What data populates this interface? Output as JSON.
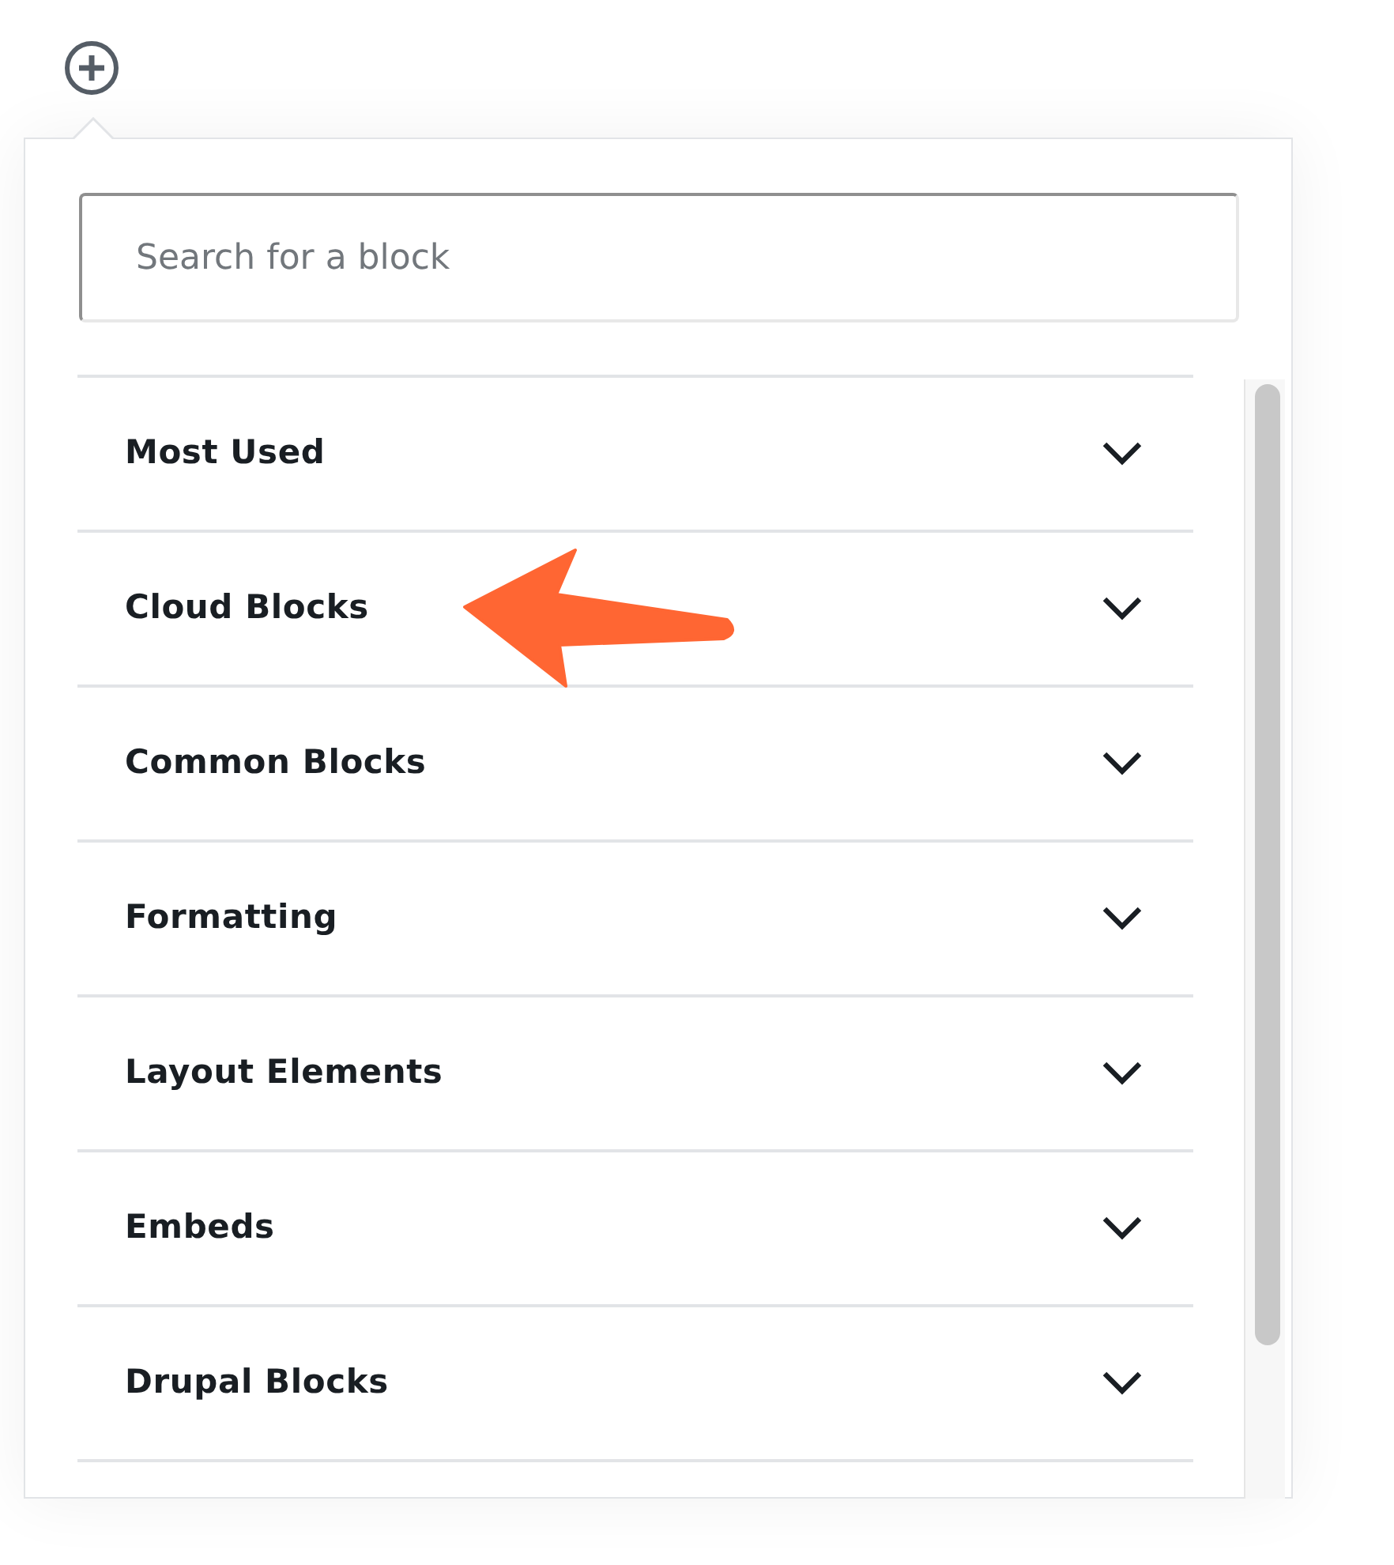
{
  "search": {
    "placeholder": "Search for a block"
  },
  "categories": [
    {
      "label": "Most Used",
      "expanded": false
    },
    {
      "label": "Cloud Blocks",
      "expanded": false
    },
    {
      "label": "Common Blocks",
      "expanded": false
    },
    {
      "label": "Formatting",
      "expanded": false
    },
    {
      "label": "Layout Elements",
      "expanded": false
    },
    {
      "label": "Embeds",
      "expanded": false
    },
    {
      "label": "Drupal Blocks",
      "expanded": false
    }
  ]
}
